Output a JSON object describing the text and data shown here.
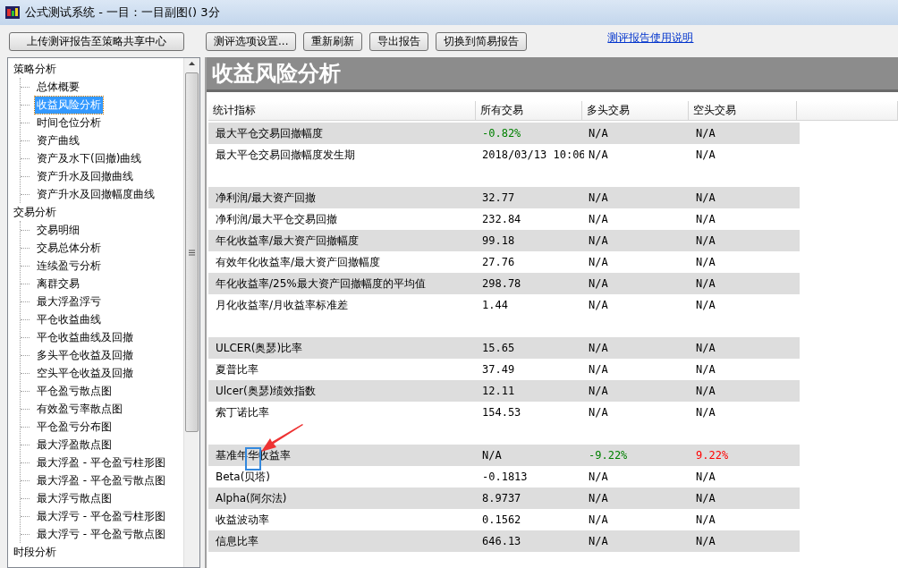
{
  "window": {
    "title": "公式测试系统 - 一目：一目副图() 3分"
  },
  "toolbar": {
    "buttons": [
      {
        "label": "上传测评报告至策略共享中心",
        "kind": "wide"
      },
      {
        "label": "测评选项设置...",
        "kind": "normal"
      },
      {
        "label": "重新刷新",
        "kind": "normal"
      },
      {
        "label": "导出报告",
        "kind": "normal"
      },
      {
        "label": "切换到简易报告",
        "kind": "normal"
      }
    ],
    "link": "测评报告使用说明"
  },
  "sidebar": {
    "items": [
      {
        "label": "策略分析",
        "selected": false,
        "children": [
          {
            "label": "总体概要",
            "selected": false
          },
          {
            "label": "收益风险分析",
            "selected": true
          },
          {
            "label": "时间仓位分析",
            "selected": false
          },
          {
            "label": "资产曲线",
            "selected": false
          },
          {
            "label": "资产及水下(回撤)曲线",
            "selected": false
          },
          {
            "label": "资产升水及回撤曲线",
            "selected": false
          },
          {
            "label": "资产升水及回撤幅度曲线",
            "selected": false
          }
        ]
      },
      {
        "label": "交易分析",
        "selected": false,
        "children": [
          {
            "label": "交易明细",
            "selected": false
          },
          {
            "label": "交易总体分析",
            "selected": false
          },
          {
            "label": "连续盈亏分析",
            "selected": false
          },
          {
            "label": "离群交易",
            "selected": false
          },
          {
            "label": "最大浮盈浮亏",
            "selected": false
          },
          {
            "label": "平仓收益曲线",
            "selected": false
          },
          {
            "label": "平仓收益曲线及回撤",
            "selected": false
          },
          {
            "label": "多头平仓收益及回撤",
            "selected": false
          },
          {
            "label": "空头平仓收益及回撤",
            "selected": false
          },
          {
            "label": "平仓盈亏散点图",
            "selected": false
          },
          {
            "label": "有效盈亏率散点图",
            "selected": false
          },
          {
            "label": "平仓盈亏分布图",
            "selected": false
          },
          {
            "label": "最大浮盈散点图",
            "selected": false
          },
          {
            "label": "最大浮盈 - 平仓盈亏柱形图",
            "selected": false
          },
          {
            "label": "最大浮盈 - 平仓盈亏散点图",
            "selected": false
          },
          {
            "label": "最大浮亏散点图",
            "selected": false
          },
          {
            "label": "最大浮亏 - 平仓盈亏柱形图",
            "selected": false
          },
          {
            "label": "最大浮亏 - 平仓盈亏散点图",
            "selected": false
          }
        ]
      },
      {
        "label": "时段分析",
        "selected": false
      }
    ]
  },
  "panel": {
    "title": "收益风险分析"
  },
  "table": {
    "columns": [
      "统计指标",
      "所有交易",
      "多头交易",
      "空头交易"
    ],
    "sections": [
      {
        "rows": [
          {
            "cells": [
              {
                "text": "最大平仓交易回撤幅度"
              },
              {
                "text": "-0.82%",
                "color": "#008000"
              },
              {
                "text": "N/A"
              },
              {
                "text": "N/A"
              }
            ]
          },
          {
            "cells": [
              {
                "text": "最大平仓交易回撤幅度发生期"
              },
              {
                "text": "2018/03/13 10:06"
              },
              {
                "text": "N/A"
              },
              {
                "text": "N/A"
              }
            ]
          }
        ]
      },
      {
        "rows": [
          {
            "cells": [
              {
                "text": "净利润/最大资产回撤"
              },
              {
                "text": "32.77"
              },
              {
                "text": "N/A"
              },
              {
                "text": "N/A"
              }
            ]
          },
          {
            "cells": [
              {
                "text": "净利润/最大平仓交易回撤"
              },
              {
                "text": "232.84"
              },
              {
                "text": "N/A"
              },
              {
                "text": "N/A"
              }
            ]
          },
          {
            "cells": [
              {
                "text": "年化收益率/最大资产回撤幅度"
              },
              {
                "text": "99.18"
              },
              {
                "text": "N/A"
              },
              {
                "text": "N/A"
              }
            ]
          },
          {
            "cells": [
              {
                "text": "有效年化收益率/最大资产回撤幅度"
              },
              {
                "text": "27.76"
              },
              {
                "text": "N/A"
              },
              {
                "text": "N/A"
              }
            ]
          },
          {
            "cells": [
              {
                "text": "年化收益率/25%最大资产回撤幅度的平均值"
              },
              {
                "text": "298.78"
              },
              {
                "text": "N/A"
              },
              {
                "text": "N/A"
              }
            ]
          },
          {
            "cells": [
              {
                "text": "月化收益率/月收益率标准差"
              },
              {
                "text": "1.44"
              },
              {
                "text": "N/A"
              },
              {
                "text": "N/A"
              }
            ]
          }
        ]
      },
      {
        "rows": [
          {
            "cells": [
              {
                "text": "ULCER(奥瑟)比率"
              },
              {
                "text": "15.65"
              },
              {
                "text": "N/A"
              },
              {
                "text": "N/A"
              }
            ]
          },
          {
            "cells": [
              {
                "text": "夏普比率"
              },
              {
                "text": "37.49"
              },
              {
                "text": "N/A"
              },
              {
                "text": "N/A"
              }
            ]
          },
          {
            "cells": [
              {
                "text": "Ulcer(奥瑟)绩效指数"
              },
              {
                "text": "12.11"
              },
              {
                "text": "N/A"
              },
              {
                "text": "N/A"
              }
            ]
          },
          {
            "cells": [
              {
                "text": "索丁诺比率"
              },
              {
                "text": "154.53"
              },
              {
                "text": "N/A"
              },
              {
                "text": "N/A"
              }
            ]
          }
        ]
      },
      {
        "rows": [
          {
            "cells": [
              {
                "text": "基准年华收益率"
              },
              {
                "text": "N/A"
              },
              {
                "text": "-9.22%",
                "color": "#008000"
              },
              {
                "text": "9.22%",
                "color": "#ff0000"
              }
            ]
          },
          {
            "cells": [
              {
                "text": "Beta(贝塔)"
              },
              {
                "text": "-0.1813"
              },
              {
                "text": "N/A"
              },
              {
                "text": "N/A"
              }
            ]
          },
          {
            "cells": [
              {
                "text": "Alpha(阿尔法)"
              },
              {
                "text": "8.9737"
              },
              {
                "text": "N/A"
              },
              {
                "text": "N/A"
              }
            ]
          },
          {
            "cells": [
              {
                "text": "收益波动率"
              },
              {
                "text": "0.1562"
              },
              {
                "text": "N/A"
              },
              {
                "text": "N/A"
              }
            ]
          },
          {
            "cells": [
              {
                "text": "信息比率"
              },
              {
                "text": "646.13"
              },
              {
                "text": "N/A"
              },
              {
                "text": "N/A"
              }
            ]
          }
        ]
      }
    ]
  }
}
